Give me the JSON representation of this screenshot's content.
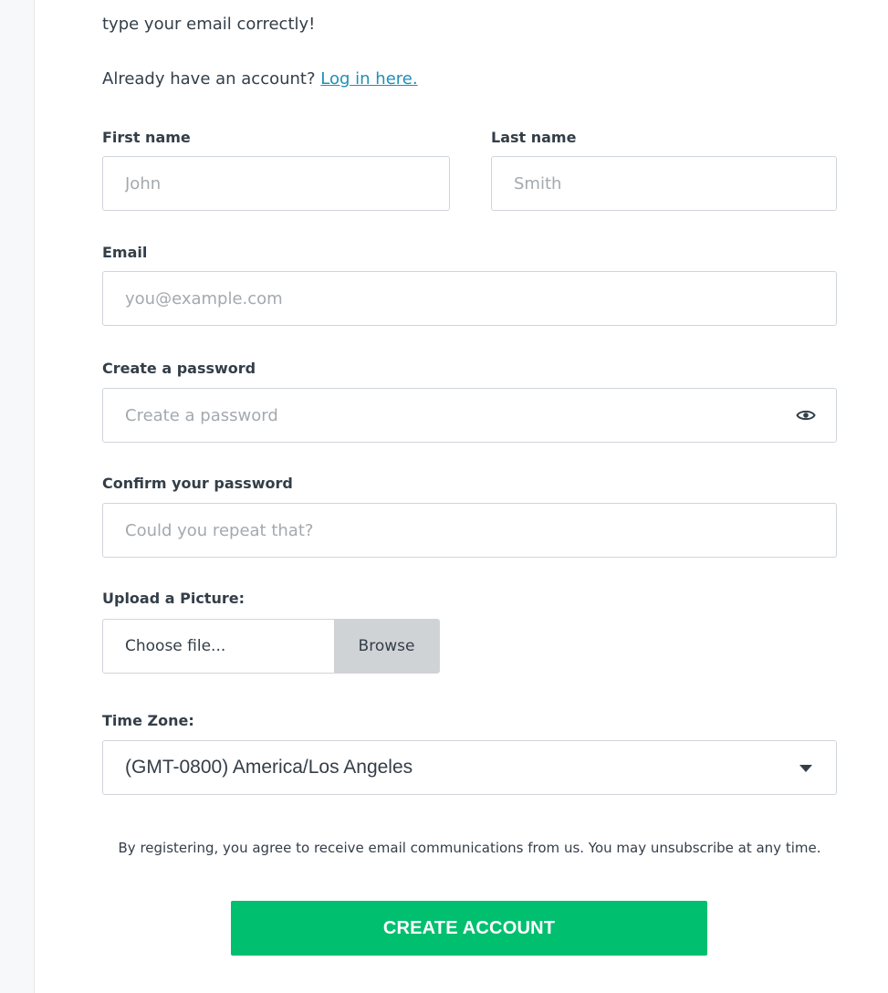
{
  "intro": {
    "text": "type your email correctly!"
  },
  "login": {
    "prompt": "Already have an account?",
    "link_text": "Log in here."
  },
  "fields": {
    "first_name": {
      "label": "First name",
      "placeholder": "John"
    },
    "last_name": {
      "label": "Last name",
      "placeholder": "Smith"
    },
    "email": {
      "label": "Email",
      "placeholder": "you@example.com"
    },
    "password": {
      "label": "Create a password",
      "placeholder": "Create a password",
      "toggle_icon": "eye-icon"
    },
    "confirm_password": {
      "label": "Confirm your password",
      "placeholder": "Could you repeat that?"
    },
    "picture": {
      "label": "Upload a Picture:",
      "file_text": "Choose file...",
      "browse_label": "Browse"
    },
    "timezone": {
      "label": "Time Zone:",
      "selected": "(GMT-0800) America/Los Angeles",
      "caret_icon": "caret-down-icon"
    }
  },
  "terms": {
    "text": "By registering, you agree to receive email communications from us. You may unsubscribe at any time."
  },
  "submit": {
    "label": "CREATE ACCOUNT"
  },
  "colors": {
    "accent_green": "#00bf6f",
    "link_blue": "#1f8fb8",
    "text": "#333e48",
    "placeholder": "#a3a9ae",
    "border": "#d0d5da",
    "browse_bg": "#d0d3d6"
  }
}
